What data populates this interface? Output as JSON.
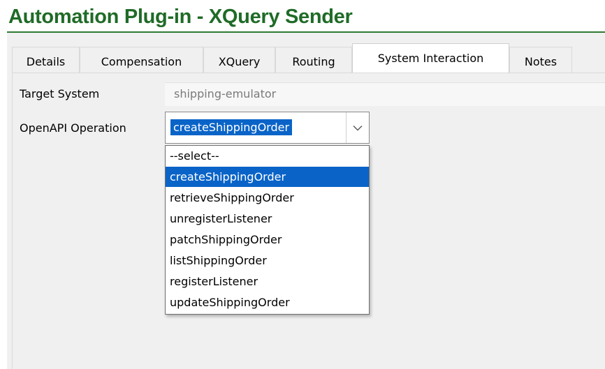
{
  "header": {
    "title": "Automation Plug-in - XQuery Sender",
    "title_color": "#1f6b27"
  },
  "tabs": [
    {
      "label": "Details",
      "active": false
    },
    {
      "label": "Compensation",
      "active": false
    },
    {
      "label": "XQuery",
      "active": false
    },
    {
      "label": "Routing",
      "active": false
    },
    {
      "label": "System Interaction",
      "active": true
    },
    {
      "label": "Notes",
      "active": false
    }
  ],
  "form": {
    "target_system_label": "Target System",
    "target_system_value": "shipping-emulator",
    "operation_label": "OpenAPI Operation",
    "operation_value": "createShippingOrder",
    "dropdown_icon": "chevron-down-icon"
  },
  "dropdown": {
    "selected_index": 1,
    "selection_color": "#0a64c8",
    "options": [
      "--select--",
      "createShippingOrder",
      "retrieveShippingOrder",
      "unregisterListener",
      "patchShippingOrder",
      "listShippingOrder",
      "registerListener",
      "updateShippingOrder"
    ]
  }
}
